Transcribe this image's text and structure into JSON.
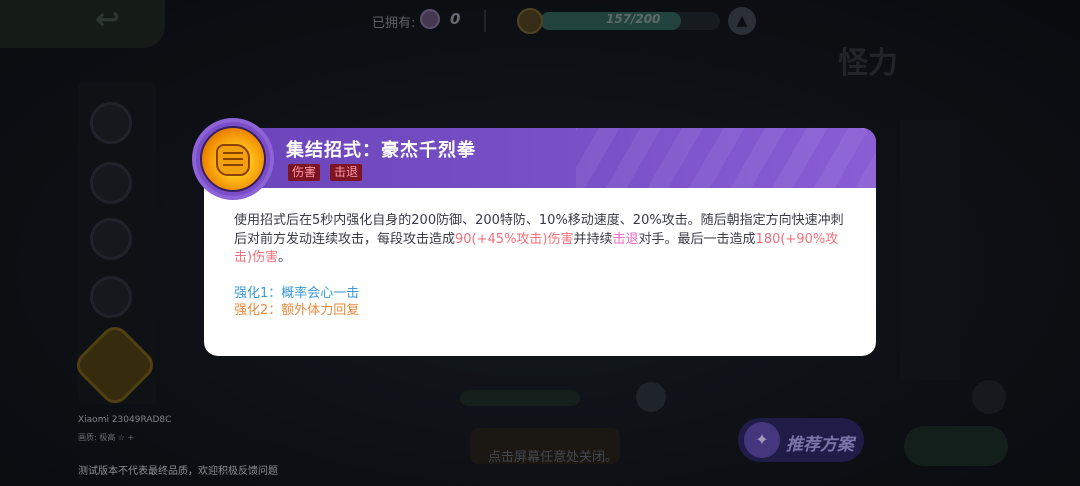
{
  "top_bar": {
    "owned_label": "已拥有:",
    "owned_count": "0",
    "exp_text": "157/200",
    "exp_fraction": 0.785
  },
  "character": {
    "name": "怪力"
  },
  "device": {
    "name": "Xiaomi 23049RAD8C",
    "quality": "画质: 极高 ☆ +",
    "test_note": "测试版本不代表最终品质，欢迎积极反馈问题"
  },
  "bottom": {
    "close_hint": "点击屏幕任意处关闭。",
    "recommend_label": "推荐方案"
  },
  "skill_popup": {
    "title": "集结招式：豪杰千烈拳",
    "tags": [
      "伤害",
      "击退"
    ],
    "desc_1": "使用招式后在5秒内强化自身的200防御、200特防、10%移动速度、20%攻击。随后朝指定方向快速冲刺后对前方发动连续攻击，每段攻击造成",
    "desc_hl_1": "90(+45%攻击)伤害",
    "desc_2": "并持续",
    "desc_hl_2": "击退",
    "desc_3": "对手。最后一击造成",
    "desc_hl_3": "180(+90%攻击)伤害",
    "desc_4": "。",
    "enhance_1": "强化1：概率会心一击",
    "enhance_2": "强化2：额外体力回复"
  },
  "colors": {
    "header_purple": "#7a52c8",
    "highlight_red": "#f2707a",
    "highlight_pink": "#ef68c2",
    "enhance_blue": "#3a9ad8",
    "enhance_orange": "#e88a3a"
  }
}
